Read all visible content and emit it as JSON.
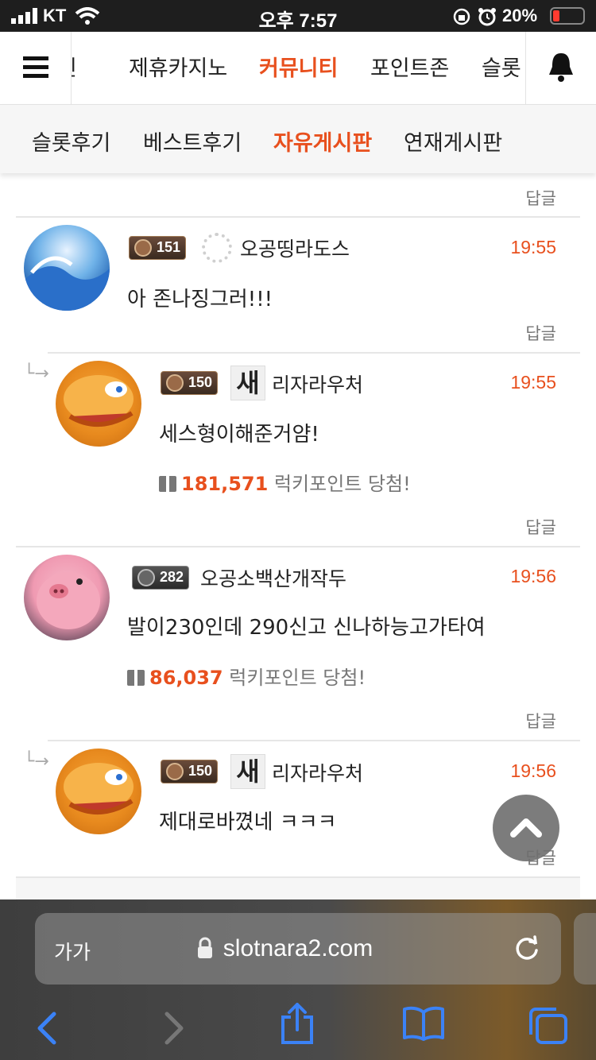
{
  "status_bar": {
    "carrier": "KT",
    "time": "오후 7:57",
    "battery_percent": "20%"
  },
  "top_nav": {
    "tabs": [
      {
        "label": "인",
        "active": false
      },
      {
        "label": "제휴카지노",
        "active": false
      },
      {
        "label": "커뮤니티",
        "active": true
      },
      {
        "label": "포인트존",
        "active": false
      },
      {
        "label": "슬롯",
        "active": false
      }
    ],
    "icons": [
      "menu-icon",
      "bell-icon"
    ]
  },
  "sub_nav": {
    "tabs": [
      {
        "label": "슬롯후기",
        "active": false
      },
      {
        "label": "베스트후기",
        "active": false
      },
      {
        "label": "자유게시판",
        "active": true
      },
      {
        "label": "연재게시판",
        "active": false
      }
    ]
  },
  "reply_label": "답글",
  "comments": [
    {
      "level": "151",
      "username": "오공띵라도스",
      "time": "19:55",
      "text": "아 존나징그러!!!",
      "is_reply": false
    },
    {
      "level": "150",
      "new_badge": "새",
      "username": "리자라우처",
      "time": "19:55",
      "text": "세스형이해준거얌!",
      "lucky_points": "181,571",
      "lucky_text": "럭키포인트 당첨!",
      "is_reply": true
    },
    {
      "level": "282",
      "username": "오공소백산개작두",
      "time": "19:56",
      "text": "발이230인데 290신고 신나하능고가타여",
      "lucky_points": "86,037",
      "lucky_text": "럭키포인트 당첨!",
      "is_reply": false
    },
    {
      "level": "150",
      "new_badge": "새",
      "username": "리자라우처",
      "time": "19:56",
      "text": "제대로바꼈네 ㅋㅋㅋ",
      "is_reply": true
    }
  ],
  "browser": {
    "text_size_label": "가가",
    "url": "slotnara2.com",
    "accent_color": "#3b82f6"
  },
  "colors": {
    "accent": "#e8501e"
  }
}
